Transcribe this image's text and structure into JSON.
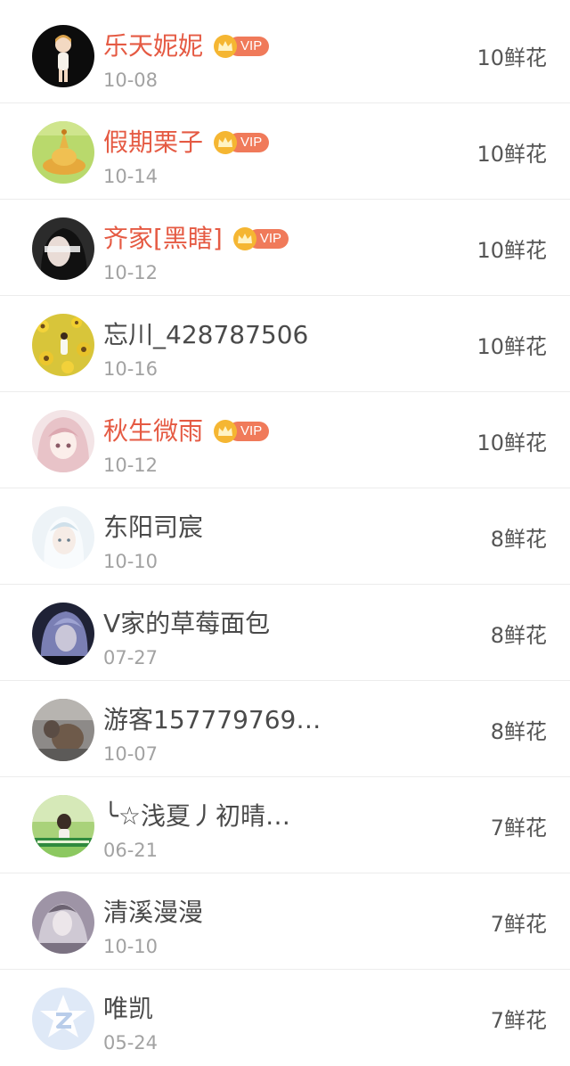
{
  "items": [
    {
      "name": "乐天妮妮",
      "vip": true,
      "date": "10-08",
      "flowers": "10鲜花"
    },
    {
      "name": "假期栗子",
      "vip": true,
      "date": "10-14",
      "flowers": "10鲜花"
    },
    {
      "name": "齐家[黑瞎]",
      "vip": true,
      "date": "10-12",
      "flowers": "10鲜花"
    },
    {
      "name": "忘川_428787506",
      "vip": false,
      "date": "10-16",
      "flowers": "10鲜花"
    },
    {
      "name": "秋生微雨",
      "vip": true,
      "date": "10-12",
      "flowers": "10鲜花"
    },
    {
      "name": "东阳司宸",
      "vip": false,
      "date": "10-10",
      "flowers": "8鲜花"
    },
    {
      "name": "V家的草莓面包",
      "vip": false,
      "date": "07-27",
      "flowers": "8鲜花"
    },
    {
      "name": "游客157779769…",
      "vip": false,
      "date": "10-07",
      "flowers": "8鲜花"
    },
    {
      "name": "╰☆浅夏丿初晴…",
      "vip": false,
      "date": "06-21",
      "flowers": "7鲜花"
    },
    {
      "name": "清溪漫漫",
      "vip": false,
      "date": "10-10",
      "flowers": "7鲜花"
    },
    {
      "name": "唯凯",
      "vip": false,
      "date": "05-24",
      "flowers": "7鲜花"
    }
  ],
  "vip_label": "VIP",
  "colors": {
    "vip_name": "#e55a43",
    "normal_name": "#4a4a4a",
    "date": "#a2a2a2",
    "vip_badge": "#f07a5a",
    "crown": "#f5b632"
  }
}
